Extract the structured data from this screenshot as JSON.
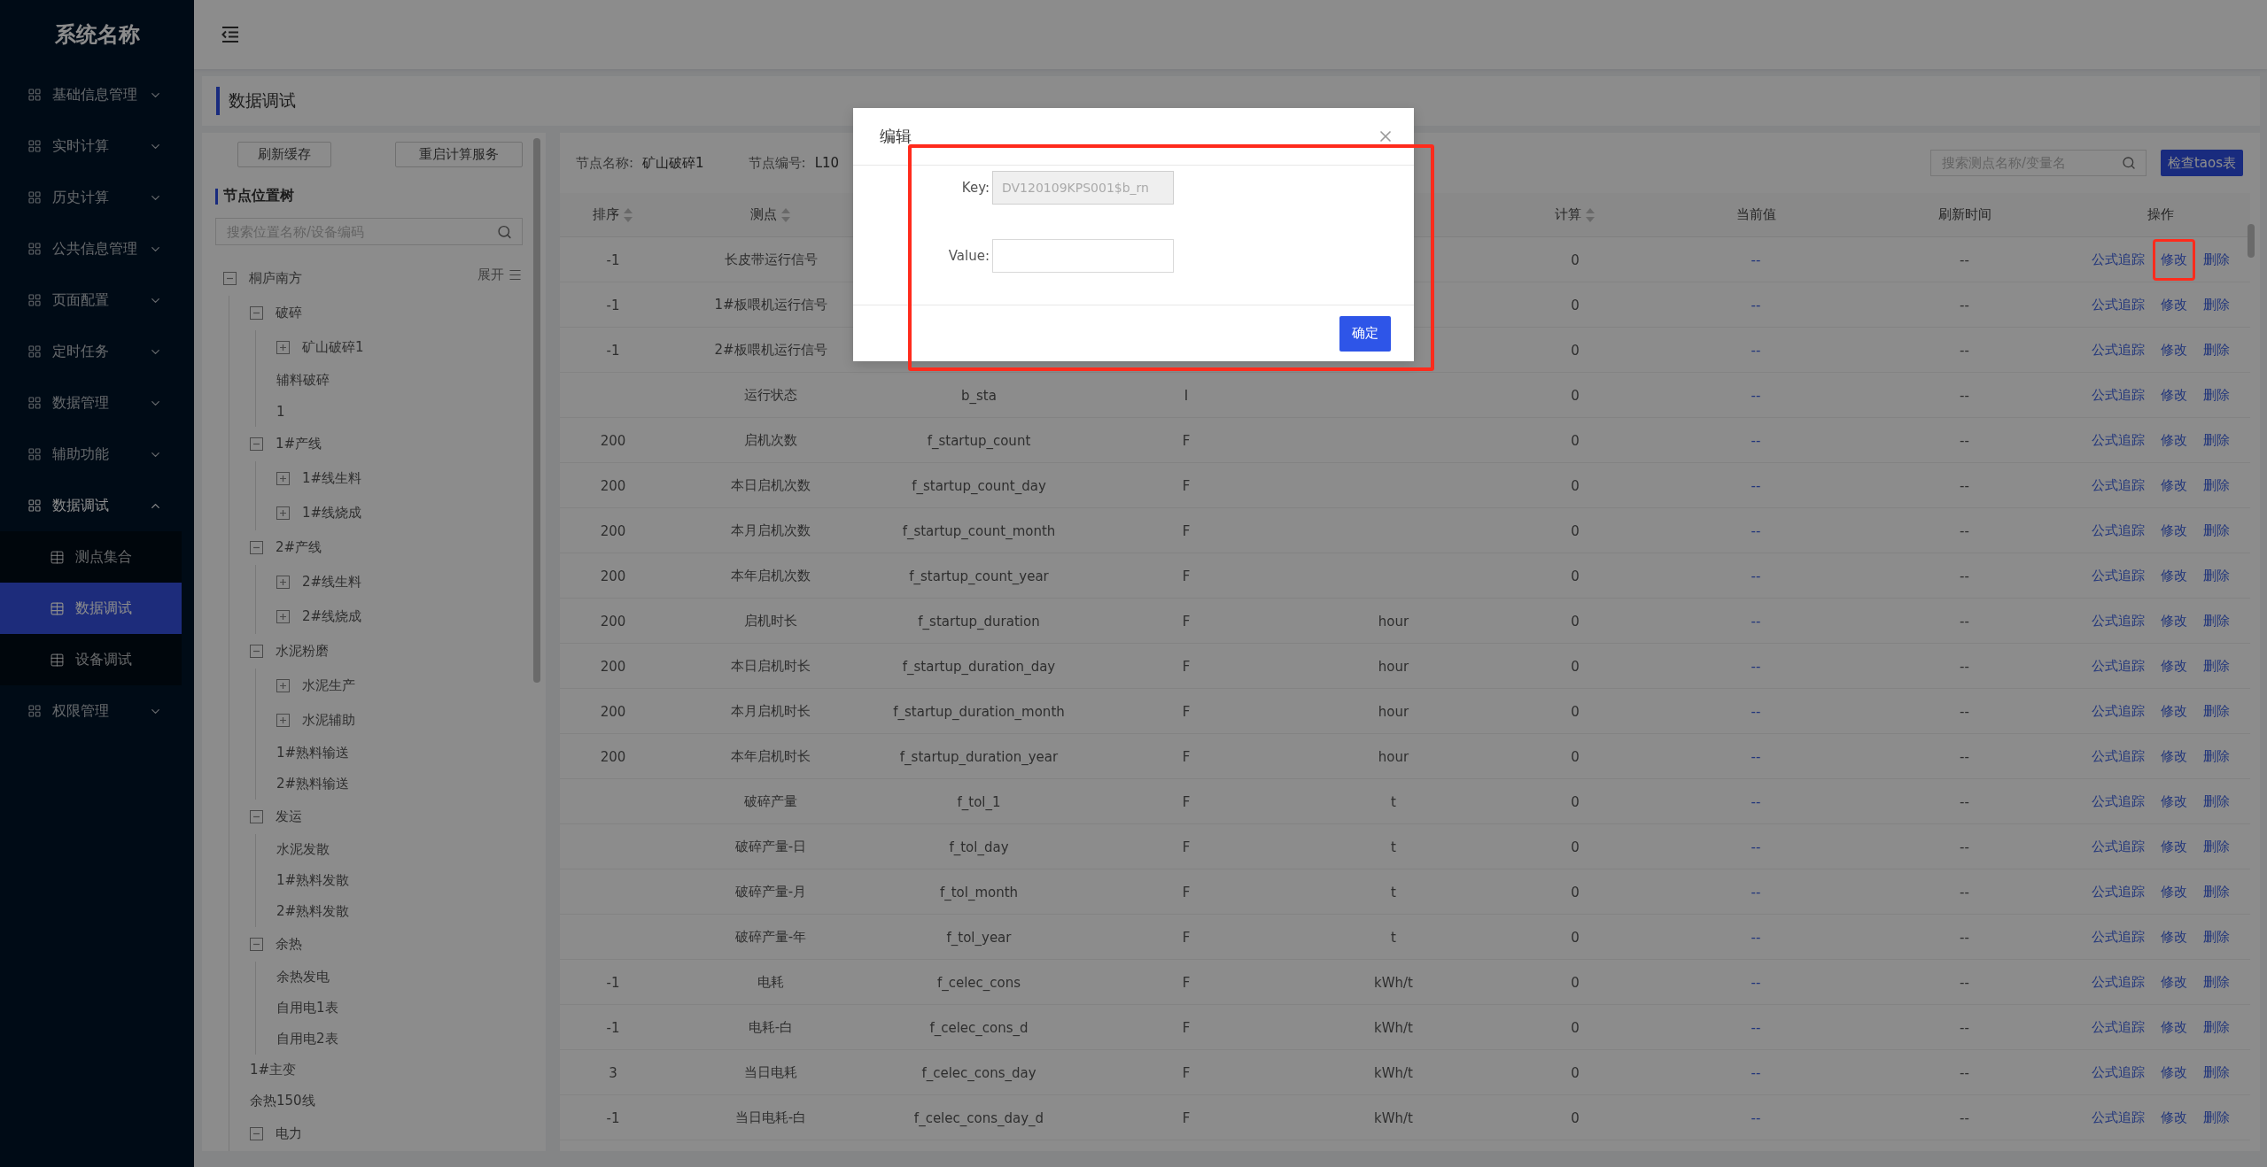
{
  "app": {
    "title": "系统名称"
  },
  "sidebar": {
    "items": [
      {
        "label": "基础信息管理",
        "expanded": false
      },
      {
        "label": "实时计算",
        "expanded": false
      },
      {
        "label": "历史计算",
        "expanded": false
      },
      {
        "label": "公共信息管理",
        "expanded": false
      },
      {
        "label": "页面配置",
        "expanded": false
      },
      {
        "label": "定时任务",
        "expanded": false
      },
      {
        "label": "数据管理",
        "expanded": false
      },
      {
        "label": "辅助功能",
        "expanded": false
      },
      {
        "label": "数据调试",
        "expanded": true,
        "children": [
          {
            "label": "测点集合",
            "selected": false
          },
          {
            "label": "数据调试",
            "selected": true
          },
          {
            "label": "设备调试",
            "selected": false
          }
        ]
      },
      {
        "label": "权限管理",
        "expanded": false
      }
    ]
  },
  "page": {
    "title": "数据调试"
  },
  "tree_panel": {
    "buttons": [
      "刷新缓存",
      "重启计算服务"
    ],
    "title": "节点位置树",
    "search": {
      "placeholder": "搜索位置名称/设备编码"
    },
    "expand_toggle": "展开",
    "tree": [
      {
        "label": "桐庐南方",
        "expanded": true,
        "children": [
          {
            "label": "破碎",
            "expanded": true,
            "children": [
              {
                "label": "矿山破碎1",
                "expanded": false
              },
              {
                "label": "辅料破碎"
              },
              {
                "label": "1"
              }
            ]
          },
          {
            "label": "1#产线",
            "expanded": true,
            "children": [
              {
                "label": "1#线生料",
                "expanded": false
              },
              {
                "label": "1#线烧成",
                "expanded": false
              }
            ]
          },
          {
            "label": "2#产线",
            "expanded": true,
            "children": [
              {
                "label": "2#线生料",
                "expanded": false
              },
              {
                "label": "2#线烧成",
                "expanded": false
              }
            ]
          },
          {
            "label": "水泥粉磨",
            "expanded": true,
            "children": [
              {
                "label": "水泥生产",
                "expanded": false
              },
              {
                "label": "水泥辅助",
                "expanded": false
              },
              {
                "label": "1#熟料输送"
              },
              {
                "label": "2#熟料输送"
              }
            ]
          },
          {
            "label": "发运",
            "expanded": true,
            "children": [
              {
                "label": "水泥发散"
              },
              {
                "label": "1#熟料发散"
              },
              {
                "label": "2#熟料发散"
              }
            ]
          },
          {
            "label": "余热",
            "expanded": true,
            "children": [
              {
                "label": "余热发电"
              },
              {
                "label": "自用电1表"
              },
              {
                "label": "自用电2表"
              }
            ]
          },
          {
            "label": "1#主变"
          },
          {
            "label": "余热150线"
          },
          {
            "label": "电力",
            "expanded": true
          }
        ]
      }
    ]
  },
  "table_panel": {
    "node_name_label": "节点名称:",
    "node_name": "矿山破碎1",
    "node_code_label": "节点编号:",
    "node_code": "L10",
    "search": {
      "placeholder": "搜索测点名称/变量名"
    },
    "check_button": "检查taos表",
    "headers": {
      "order": {
        "label": "排序",
        "sortable": true
      },
      "point": {
        "label": "测点",
        "sortable": true
      },
      "calc": {
        "label": "计算",
        "sortable": true
      },
      "current": {
        "label": "当前值",
        "sortable": false
      },
      "refreshed": {
        "label": "刷新时间",
        "sortable": false
      },
      "actions": {
        "label": "操作",
        "sortable": false
      }
    },
    "rows": [
      {
        "order": "-1",
        "point": "长皮带运行信号",
        "calc": "0",
        "current": "--",
        "refreshed": "--",
        "actions": [
          {
            "label": "公式追踪",
            "highlighted": false
          },
          {
            "label": "修改",
            "highlighted": true
          },
          {
            "label": "删除",
            "highlighted": false
          }
        ]
      },
      {
        "order": "-1",
        "point": "1#板喂机运行信号",
        "calc": "0",
        "current": "--",
        "refreshed": "--",
        "actions": [
          {
            "label": "公式追踪",
            "highlighted": false
          },
          {
            "label": "修改",
            "highlighted": false
          },
          {
            "label": "删除",
            "highlighted": false
          }
        ]
      },
      {
        "order": "-1",
        "point": "2#板喂机运行信号",
        "calc": "0",
        "current": "--",
        "refreshed": "--",
        "actions": [
          {
            "label": "公式追踪",
            "highlighted": false
          },
          {
            "label": "修改",
            "highlighted": false
          },
          {
            "label": "删除",
            "highlighted": false
          }
        ]
      },
      {
        "point": "运行状态",
        "variable": "b_sta",
        "type": "I",
        "calc": "0",
        "current": "--",
        "refreshed": "--",
        "actions": [
          {
            "label": "公式追踪",
            "highlighted": false
          },
          {
            "label": "修改",
            "highlighted": false
          },
          {
            "label": "删除",
            "highlighted": false
          }
        ]
      },
      {
        "order": "200",
        "point": "启机次数",
        "variable": "f_startup_count",
        "type": "F",
        "calc": "0",
        "current": "--",
        "refreshed": "--",
        "actions": [
          {
            "label": "公式追踪",
            "highlighted": false
          },
          {
            "label": "修改",
            "highlighted": false
          },
          {
            "label": "删除",
            "highlighted": false
          }
        ]
      },
      {
        "order": "200",
        "point": "本日启机次数",
        "variable": "f_startup_count_day",
        "type": "F",
        "calc": "0",
        "current": "--",
        "refreshed": "--",
        "actions": [
          {
            "label": "公式追踪",
            "highlighted": false
          },
          {
            "label": "修改",
            "highlighted": false
          },
          {
            "label": "删除",
            "highlighted": false
          }
        ]
      },
      {
        "order": "200",
        "point": "本月启机次数",
        "variable": "f_startup_count_month",
        "type": "F",
        "calc": "0",
        "current": "--",
        "refreshed": "--",
        "actions": [
          {
            "label": "公式追踪",
            "highlighted": false
          },
          {
            "label": "修改",
            "highlighted": false
          },
          {
            "label": "删除",
            "highlighted": false
          }
        ]
      },
      {
        "order": "200",
        "point": "本年启机次数",
        "variable": "f_startup_count_year",
        "type": "F",
        "calc": "0",
        "current": "--",
        "refreshed": "--",
        "actions": [
          {
            "label": "公式追踪",
            "highlighted": false
          },
          {
            "label": "修改",
            "highlighted": false
          },
          {
            "label": "删除",
            "highlighted": false
          }
        ]
      },
      {
        "order": "200",
        "point": "启机时长",
        "variable": "f_startup_duration",
        "type": "F",
        "unit": "hour",
        "calc": "0",
        "current": "--",
        "refreshed": "--",
        "actions": [
          {
            "label": "公式追踪",
            "highlighted": false
          },
          {
            "label": "修改",
            "highlighted": false
          },
          {
            "label": "删除",
            "highlighted": false
          }
        ]
      },
      {
        "order": "200",
        "point": "本日启机时长",
        "variable": "f_startup_duration_day",
        "type": "F",
        "unit": "hour",
        "calc": "0",
        "current": "--",
        "refreshed": "--",
        "actions": [
          {
            "label": "公式追踪",
            "highlighted": false
          },
          {
            "label": "修改",
            "highlighted": false
          },
          {
            "label": "删除",
            "highlighted": false
          }
        ]
      },
      {
        "order": "200",
        "point": "本月启机时长",
        "variable": "f_startup_duration_month",
        "type": "F",
        "unit": "hour",
        "calc": "0",
        "current": "--",
        "refreshed": "--",
        "actions": [
          {
            "label": "公式追踪",
            "highlighted": false
          },
          {
            "label": "修改",
            "highlighted": false
          },
          {
            "label": "删除",
            "highlighted": false
          }
        ]
      },
      {
        "order": "200",
        "point": "本年启机时长",
        "variable": "f_startup_duration_year",
        "type": "F",
        "unit": "hour",
        "calc": "0",
        "current": "--",
        "refreshed": "--",
        "actions": [
          {
            "label": "公式追踪",
            "highlighted": false
          },
          {
            "label": "修改",
            "highlighted": false
          },
          {
            "label": "删除",
            "highlighted": false
          }
        ]
      },
      {
        "point": "破碎产量",
        "variable": "f_tol_1",
        "type": "F",
        "unit": "t",
        "calc": "0",
        "current": "--",
        "refreshed": "--",
        "actions": [
          {
            "label": "公式追踪",
            "highlighted": false
          },
          {
            "label": "修改",
            "highlighted": false
          },
          {
            "label": "删除",
            "highlighted": false
          }
        ]
      },
      {
        "point": "破碎产量-日",
        "variable": "f_tol_day",
        "type": "F",
        "unit": "t",
        "calc": "0",
        "current": "--",
        "refreshed": "--",
        "actions": [
          {
            "label": "公式追踪",
            "highlighted": false
          },
          {
            "label": "修改",
            "highlighted": false
          },
          {
            "label": "删除",
            "highlighted": false
          }
        ]
      },
      {
        "point": "破碎产量-月",
        "variable": "f_tol_month",
        "type": "F",
        "unit": "t",
        "calc": "0",
        "current": "--",
        "refreshed": "--",
        "actions": [
          {
            "label": "公式追踪",
            "highlighted": false
          },
          {
            "label": "修改",
            "highlighted": false
          },
          {
            "label": "删除",
            "highlighted": false
          }
        ]
      },
      {
        "point": "破碎产量-年",
        "variable": "f_tol_year",
        "type": "F",
        "unit": "t",
        "calc": "0",
        "current": "--",
        "refreshed": "--",
        "actions": [
          {
            "label": "公式追踪",
            "highlighted": false
          },
          {
            "label": "修改",
            "highlighted": false
          },
          {
            "label": "删除",
            "highlighted": false
          }
        ]
      },
      {
        "order": "-1",
        "point": "电耗",
        "variable": "f_celec_cons",
        "type": "F",
        "unit": "kWh/t",
        "calc": "0",
        "current": "--",
        "refreshed": "--",
        "actions": [
          {
            "label": "公式追踪",
            "highlighted": false
          },
          {
            "label": "修改",
            "highlighted": false
          },
          {
            "label": "删除",
            "highlighted": false
          }
        ]
      },
      {
        "order": "-1",
        "point": "电耗-白",
        "variable": "f_celec_cons_d",
        "type": "F",
        "unit": "kWh/t",
        "calc": "0",
        "current": "--",
        "refreshed": "--",
        "actions": [
          {
            "label": "公式追踪",
            "highlighted": false
          },
          {
            "label": "修改",
            "highlighted": false
          },
          {
            "label": "删除",
            "highlighted": false
          }
        ]
      },
      {
        "order": "3",
        "point": "当日电耗",
        "variable": "f_celec_cons_day",
        "type": "F",
        "unit": "kWh/t",
        "calc": "0",
        "current": "--",
        "refreshed": "--",
        "actions": [
          {
            "label": "公式追踪",
            "highlighted": false
          },
          {
            "label": "修改",
            "highlighted": false
          },
          {
            "label": "删除",
            "highlighted": false
          }
        ]
      },
      {
        "order": "-1",
        "point": "当日电耗-白",
        "variable": "f_celec_cons_day_d",
        "type": "F",
        "unit": "kWh/t",
        "calc": "0",
        "current": "--",
        "refreshed": "--",
        "actions": [
          {
            "label": "公式追踪",
            "highlighted": false
          },
          {
            "label": "修改",
            "highlighted": false
          },
          {
            "label": "删除",
            "highlighted": false
          }
        ]
      }
    ]
  },
  "modal": {
    "title": "编辑",
    "highlighted": true,
    "fields": [
      {
        "label": "Key:",
        "value": "DV120109KPS001$b_rn",
        "disabled": true
      },
      {
        "label": "Value:",
        "disabled": false
      }
    ],
    "confirm_button": "确定"
  }
}
